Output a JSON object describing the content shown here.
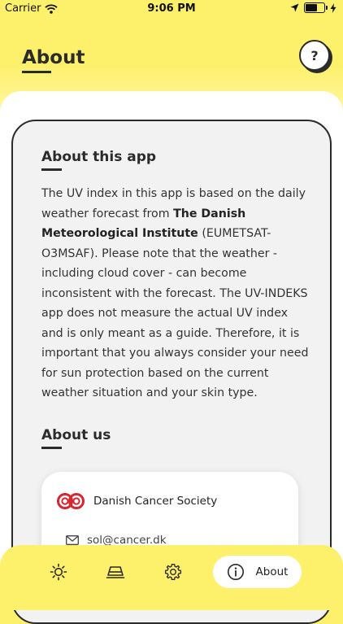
{
  "status_bar": {
    "carrier": "Carrier",
    "time": "9:06 PM",
    "icons": [
      "wifi-icon",
      "location-arrow-icon",
      "battery-icon",
      "charging-bolt-icon"
    ]
  },
  "header": {
    "title": "About",
    "help_label": "?"
  },
  "about_app": {
    "title": "About this app",
    "text_before": "The UV index in this app is based on the daily weather forecast from ",
    "text_bold": "The Danish Meteorological Institute",
    "text_after": " (EUMETSAT-O3MSAF). Please note that the weather - including cloud cover - can become inconsistent with the forecast. The UV-INDEKS app does not measure the actual UV index and is only meant as a guide. Therefore, it is important that you always consider your need for sun protection based on the current weather situation and your skin type."
  },
  "about_us": {
    "title": "About us",
    "organization": "Danish Cancer Society",
    "email": "sol@cancer.dk",
    "icons": [
      "danish-cancer-society-logo",
      "mail-icon"
    ]
  },
  "tab_bar": {
    "tabs": [
      {
        "icon": "sun-icon"
      },
      {
        "icon": "device-icon"
      },
      {
        "icon": "gear-icon"
      },
      {
        "icon": "info-icon",
        "label": "About",
        "selected": true
      }
    ]
  },
  "colors": {
    "accent_yellow": "#fdf06a",
    "ink": "#2b2b2b",
    "card_bg": "#f2f2f2",
    "logo_red": "#d7262f"
  }
}
